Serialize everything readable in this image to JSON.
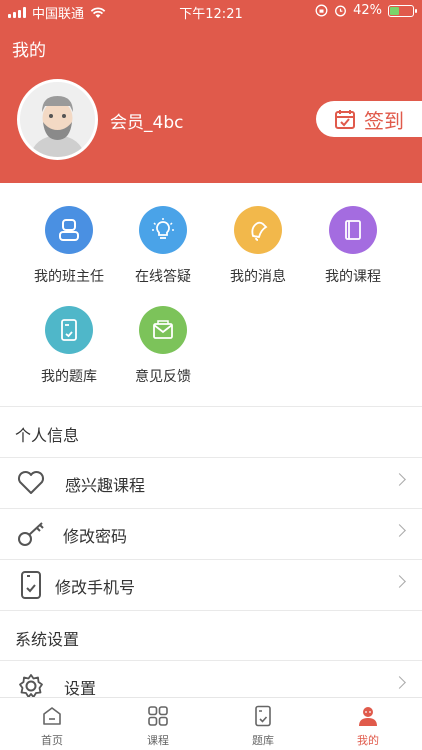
{
  "status_bar": {
    "carrier": "中国联通",
    "time": "下午12:21",
    "battery": "42%",
    "battery_level": 0.42
  },
  "header": {
    "title": "我的",
    "username": "会员_4bc",
    "checkin_label": "签到"
  },
  "quick_actions": [
    {
      "label": "我的班主任",
      "icon": "headteacher-icon",
      "color": "#4a90e2"
    },
    {
      "label": "在线答疑",
      "icon": "lightbulb-icon",
      "color": "#4aa3e8"
    },
    {
      "label": "我的消息",
      "icon": "bell-icon",
      "color": "#f2b84b"
    },
    {
      "label": "我的课程",
      "icon": "book-icon",
      "color": "#a46ce0"
    },
    {
      "label": "我的题库",
      "icon": "question-bank-icon",
      "color": "#4fb7c9"
    },
    {
      "label": "意见反馈",
      "icon": "envelope-icon",
      "color": "#7cc35a"
    }
  ],
  "sections": {
    "personal_title": "个人信息",
    "system_title": "系统设置"
  },
  "menu": {
    "interest": "感兴趣课程",
    "password": "修改密码",
    "phone": "修改手机号",
    "settings": "设置"
  },
  "tabbar": [
    {
      "label": "首页",
      "icon": "home-icon"
    },
    {
      "label": "课程",
      "icon": "grid-icon"
    },
    {
      "label": "题库",
      "icon": "question-bank-icon"
    },
    {
      "label": "我的",
      "icon": "person-icon",
      "active": true
    }
  ],
  "colors": {
    "accent": "#e05a4b"
  }
}
